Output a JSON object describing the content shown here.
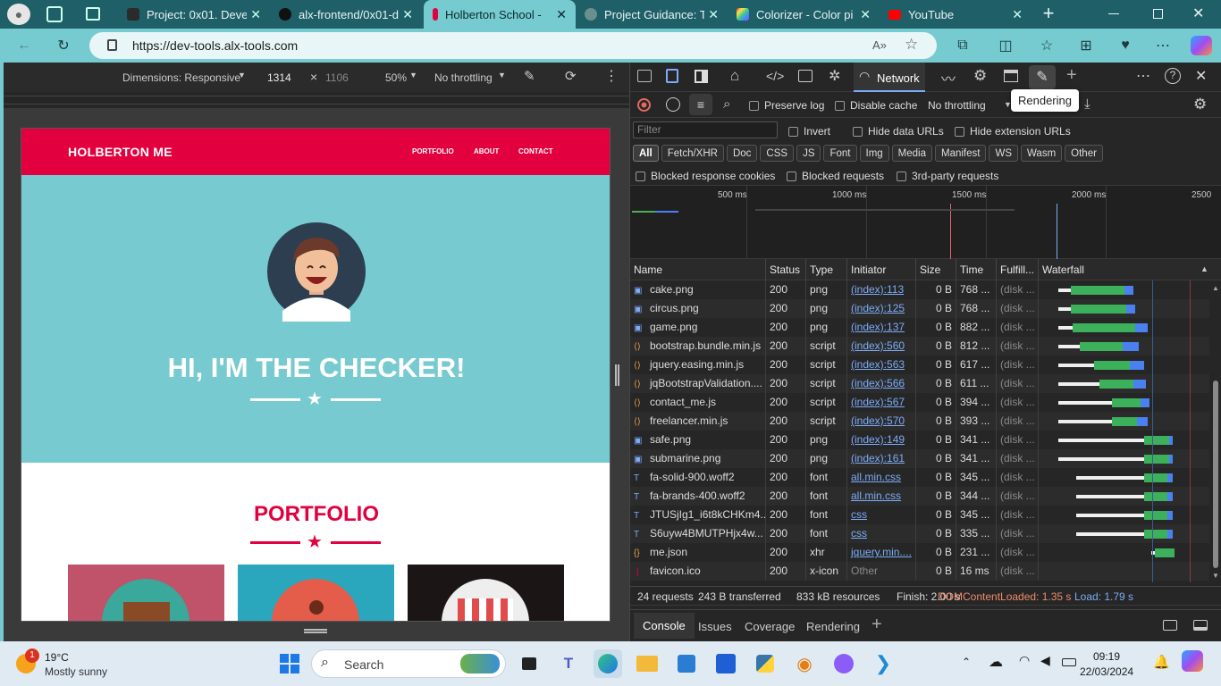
{
  "tabs": [
    {
      "title": "Project: 0x01. Devel",
      "favicon_color": "#2b2b2b"
    },
    {
      "title": "alx-frontend/0x01-d",
      "favicon_color": "#111111"
    },
    {
      "title": "Holberton School -",
      "favicon_color": "#e2003f"
    },
    {
      "title": "Project Guidance: Ta",
      "favicon_color": "#6b8f8c"
    },
    {
      "title": "Colorizer - Color pi",
      "favicon_color": "#b44fd6"
    },
    {
      "title": "YouTube",
      "favicon_color": "#ff0000"
    }
  ],
  "address": {
    "url": "https://dev-tools.alx-tools.com",
    "reader_label": "A»"
  },
  "device_toolbar": {
    "dimensions": "Dimensions: Responsive",
    "width": "1314",
    "times": "×",
    "height": "1106",
    "zoom": "50%",
    "throttling": "No throttling"
  },
  "site": {
    "brand": "HOLBERTON ME",
    "nav": [
      "PORTFOLIO",
      "ABOUT",
      "CONTACT"
    ],
    "headline": "HI, I'M THE CHECKER!",
    "portfolio_title": "PORTFOLIO",
    "colors": {
      "brand": "#e2003f",
      "hero": "#77cad0"
    }
  },
  "devtools": {
    "tabs": {
      "network": "Network"
    },
    "tooltip": "Rendering",
    "toolbar": {
      "preserve_log": "Preserve log",
      "disable_cache": "Disable cache",
      "throttling": "No throttling"
    },
    "filter_placeholder": "Filter",
    "filter_options": {
      "invert": "Invert",
      "hide_data": "Hide data URLs",
      "hide_ext": "Hide extension URLs"
    },
    "type_chips": [
      "All",
      "Fetch/XHR",
      "Doc",
      "CSS",
      "JS",
      "Font",
      "Img",
      "Media",
      "Manifest",
      "WS",
      "Wasm",
      "Other"
    ],
    "extra_filters": [
      "Blocked response cookies",
      "Blocked requests",
      "3rd-party requests"
    ],
    "timeline_ticks": [
      "500 ms",
      "1000 ms",
      "1500 ms",
      "2000 ms",
      "2500"
    ],
    "columns": [
      "Name",
      "Status",
      "Type",
      "Initiator",
      "Size",
      "Time",
      "Fulfill...",
      "Waterfall"
    ],
    "rows": [
      {
        "icon": "img",
        "name": "cake.png",
        "status": "200",
        "type": "png",
        "initiator": "(index):113",
        "size": "0 B",
        "time": "768 ...",
        "fulfill": "(disk ..."
      },
      {
        "icon": "img",
        "name": "circus.png",
        "status": "200",
        "type": "png",
        "initiator": "(index):125",
        "size": "0 B",
        "time": "768 ...",
        "fulfill": "(disk ..."
      },
      {
        "icon": "img",
        "name": "game.png",
        "status": "200",
        "type": "png",
        "initiator": "(index):137",
        "size": "0 B",
        "time": "882 ...",
        "fulfill": "(disk ..."
      },
      {
        "icon": "script",
        "name": "bootstrap.bundle.min.js",
        "status": "200",
        "type": "script",
        "initiator": "(index):560",
        "size": "0 B",
        "time": "812 ...",
        "fulfill": "(disk ..."
      },
      {
        "icon": "script",
        "name": "jquery.easing.min.js",
        "status": "200",
        "type": "script",
        "initiator": "(index):563",
        "size": "0 B",
        "time": "617 ...",
        "fulfill": "(disk ..."
      },
      {
        "icon": "script",
        "name": "jqBootstrapValidation....",
        "status": "200",
        "type": "script",
        "initiator": "(index):566",
        "size": "0 B",
        "time": "611 ...",
        "fulfill": "(disk ..."
      },
      {
        "icon": "script",
        "name": "contact_me.js",
        "status": "200",
        "type": "script",
        "initiator": "(index):567",
        "size": "0 B",
        "time": "394 ...",
        "fulfill": "(disk ..."
      },
      {
        "icon": "script",
        "name": "freelancer.min.js",
        "status": "200",
        "type": "script",
        "initiator": "(index):570",
        "size": "0 B",
        "time": "393 ...",
        "fulfill": "(disk ..."
      },
      {
        "icon": "img",
        "name": "safe.png",
        "status": "200",
        "type": "png",
        "initiator": "(index):149",
        "size": "0 B",
        "time": "341 ...",
        "fulfill": "(disk ..."
      },
      {
        "icon": "img",
        "name": "submarine.png",
        "status": "200",
        "type": "png",
        "initiator": "(index):161",
        "size": "0 B",
        "time": "341 ...",
        "fulfill": "(disk ..."
      },
      {
        "icon": "font",
        "name": "fa-solid-900.woff2",
        "status": "200",
        "type": "font",
        "initiator": "all.min.css",
        "size": "0 B",
        "time": "345 ...",
        "fulfill": "(disk ..."
      },
      {
        "icon": "font",
        "name": "fa-brands-400.woff2",
        "status": "200",
        "type": "font",
        "initiator": "all.min.css",
        "size": "0 B",
        "time": "344 ...",
        "fulfill": "(disk ..."
      },
      {
        "icon": "font",
        "name": "JTUSjIg1_i6t8kCHKm4...",
        "status": "200",
        "type": "font",
        "initiator": "css",
        "size": "0 B",
        "time": "345 ...",
        "fulfill": "(disk ..."
      },
      {
        "icon": "font",
        "name": "S6uyw4BMUTPHjx4w...",
        "status": "200",
        "type": "font",
        "initiator": "css",
        "size": "0 B",
        "time": "335 ...",
        "fulfill": "(disk ..."
      },
      {
        "icon": "xhr",
        "name": "me.json",
        "status": "200",
        "type": "xhr",
        "initiator": "jquery.min....",
        "size": "0 B",
        "time": "231 ...",
        "fulfill": "(disk ..."
      },
      {
        "icon": "favicon",
        "name": "favicon.ico",
        "status": "200",
        "type": "x-icon",
        "initiator": "Other",
        "size": "0 B",
        "time": "16 ms",
        "fulfill": "(disk ..."
      }
    ],
    "summary": {
      "requests": "24 requests",
      "transferred": "243 B transferred",
      "resources": "833 kB resources",
      "finish": "Finish: 2.00 s",
      "dcl": "DOMContentLoaded: 1.35 s",
      "load": "Load: 1.79 s"
    },
    "drawer_tabs": [
      "Console",
      "Issues",
      "Coverage",
      "Rendering"
    ]
  },
  "taskbar": {
    "weather_temp": "19°C",
    "weather_desc": "Mostly sunny",
    "notification_count": "1",
    "search": "Search",
    "time": "09:19",
    "date": "22/03/2024"
  }
}
